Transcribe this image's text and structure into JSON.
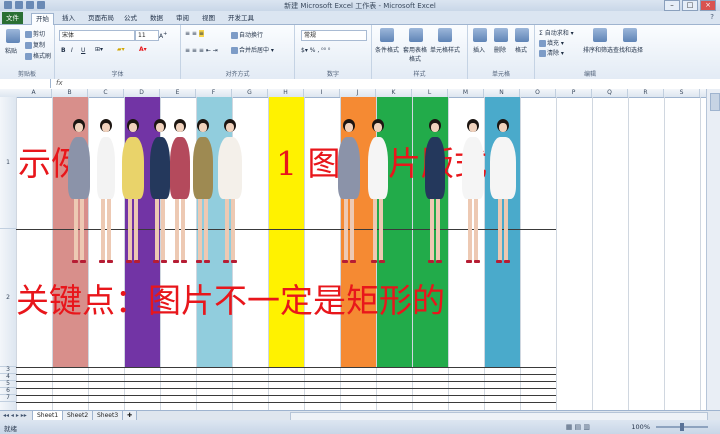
{
  "window": {
    "title": "新建 Microsoft Excel 工作表 - Microsoft Excel"
  },
  "tabs": [
    "文件",
    "开始",
    "插入",
    "页面布局",
    "公式",
    "数据",
    "审阅",
    "视图",
    "开发工具"
  ],
  "ribbon": {
    "clipboard": {
      "paste": "粘贴",
      "cut": "剪切",
      "copy": "复制",
      "format_painter": "格式刷",
      "label": "剪贴板"
    },
    "font": {
      "name": "宋体",
      "size": "11",
      "label": "字体",
      "bold": "B",
      "italic": "I",
      "underline": "U"
    },
    "alignment": {
      "wrap": "自动换行",
      "merge": "合并后居中",
      "label": "对齐方式"
    },
    "number": {
      "format": "常规",
      "label": "数字"
    },
    "styles": {
      "conditional": "条件格式",
      "table": "套用表格格式",
      "cell_styles": "单元格样式",
      "label": "样式"
    },
    "cells": {
      "insert": "插入",
      "delete": "删除",
      "format": "格式",
      "label": "单元格"
    },
    "editing": {
      "autosum": "自动求和",
      "fill": "填充",
      "clear": "清除",
      "sort": "排序和筛选",
      "find": "查找和选择",
      "label": "编辑"
    }
  },
  "formula_bar": {
    "name_box": "",
    "fx": "fx",
    "content": ""
  },
  "columns": [
    "A",
    "B",
    "C",
    "D",
    "E",
    "F",
    "G",
    "H",
    "I",
    "J",
    "K",
    "L",
    "M",
    "N",
    "O",
    "P",
    "Q",
    "R",
    "S"
  ],
  "rows": [
    "1",
    "2",
    "3",
    "4",
    "5",
    "6",
    "7"
  ],
  "content": {
    "line1_left": "示例",
    "line1_right": "1 图",
    "line1_tail": "片版式",
    "line2": "关键点：图片不一定是矩形的"
  },
  "stripe_colors": {
    "B": "#d88f8b",
    "D": "#7234a5",
    "F": "#91cddd",
    "H": "#fff200",
    "J": "#f58a33",
    "K": "#22ab4a",
    "L": "#22ab4a",
    "N": "#4aaacb"
  },
  "sheets": [
    "Sheet1",
    "Sheet2",
    "Sheet3"
  ],
  "status": {
    "ready": "就绪",
    "zoom": "100%"
  }
}
